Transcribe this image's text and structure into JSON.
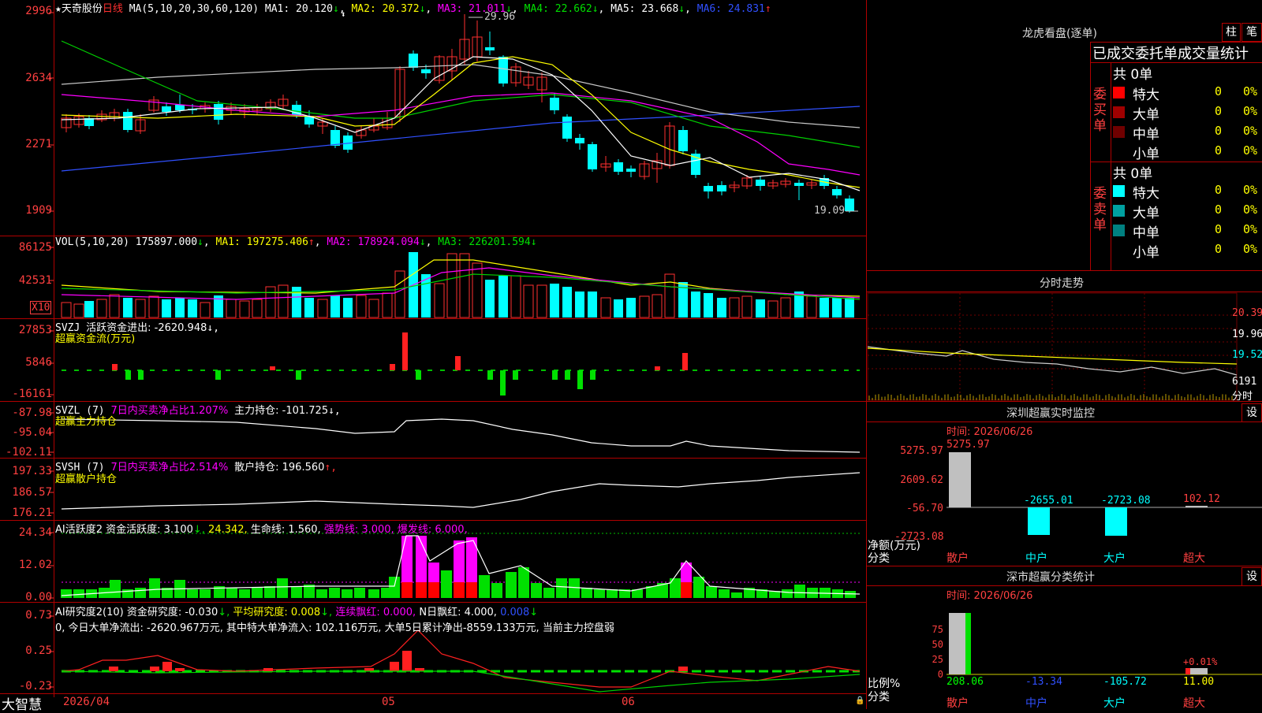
{
  "stock": {
    "star": "★",
    "name": "天奇股份",
    "period": "日线"
  },
  "price_panel": {
    "ma_params": "MA(5,10,20,30,60,120)",
    "ma1": "MA1: 20.120",
    "ma1_arrow": "↓",
    "ma2": "MA2: 20.372",
    "ma2_arrow": "↓",
    "ma3": "MA3: 21.011",
    "ma3_arrow": "↓",
    "ma4": "MA4: 22.662",
    "ma4_arrow": "↓",
    "ma5": "MA5: 23.668",
    "ma5_arrow": "↓",
    "ma6": "MA6: 24.831",
    "ma6_arrow": "↑",
    "y_labels": [
      "2996",
      "2634",
      "2271",
      "1909"
    ],
    "high_label": "29.96",
    "low_label": "19.09"
  },
  "vol_panel": {
    "title": "VOL(5,10,20)",
    "value": "175897.000",
    "arrow": "↓",
    "ma1": "MA1: 197275.406",
    "ma1_arrow": "↑",
    "ma2": "MA2: 178924.094",
    "ma2_arrow": "↓",
    "ma3": "MA3: 226201.594",
    "ma3_arrow": "↓",
    "y_labels": [
      "86125",
      "42531"
    ],
    "unit": "X10"
  },
  "svzj_panel": {
    "title": "SVZJ",
    "label": "活跃资金进出: -2620.948",
    "arrow": "↓,",
    "subtitle": "超赢资金流(万元)",
    "y_labels": [
      "27853",
      "5846",
      "-16161"
    ]
  },
  "svzl_panel": {
    "title": "SVZL (7)",
    "ratio": "7日内买卖净占比1.207%",
    "holding": "主力持仓: -101.725",
    "arrow": "↓,",
    "subtitle": "超赢主力持仓",
    "y_labels": [
      "-87.98",
      "-95.04",
      "-102.11"
    ]
  },
  "svsh_panel": {
    "title": "SVSH (7)",
    "ratio": "7日内买卖净占比2.514%",
    "holding": "散户持仓: 196.560",
    "arrow": "↑,",
    "subtitle": "超赢散户持仓",
    "y_labels": [
      "197.33",
      "186.57",
      "176.21"
    ]
  },
  "ai_active_panel": {
    "title": "AI活跃度2",
    "l1": "资金活跃度: 3.100",
    "l1a": "↓,",
    "l2": "24.342,",
    "l3": "生命线: 1.560,",
    "l4": "强势线: 3.000,",
    "l5": "爆发线: 6.000,",
    "y_labels": [
      "24.34",
      "12.02",
      "0.00"
    ]
  },
  "ai_research_panel": {
    "title": "AI研究度2(10)",
    "l1": "资金研究度: -0.030",
    "l1a": "↓,",
    "l2": "平均研究度: 0.008",
    "l2a": "↓,",
    "l3": "连续飘红: 0.000,",
    "l4": "N日飘红: 4.000,",
    "l5": "0.008",
    "l5a": "↓",
    "summary": "0, 今日大单净流出: -2620.967万元, 其中特大单净流入: 102.116万元, 大单5日累计净出-8559.133万元, 当前主力控盘弱",
    "y_labels": [
      "0.73",
      "0.25",
      "-0.23"
    ]
  },
  "bottom_axis": {
    "logo": "大智慧",
    "dates": [
      "2026/04",
      "05",
      "06"
    ]
  },
  "right": {
    "lhb_title": "龙虎看盘(逐单)",
    "btn_zhu": "柱",
    "btn_bi": "笔",
    "section_title": "已成交委托单成交量统计",
    "buy_label": "委买单",
    "sell_label": "委卖单",
    "buy_total": "共 0单",
    "sell_total": "共 0单",
    "buy_rows": [
      {
        "name": "特大",
        "count": "0",
        "pct": "0%",
        "color": "#ff0000"
      },
      {
        "name": "大单",
        "count": "0",
        "pct": "0%",
        "color": "#a00000"
      },
      {
        "name": "中单",
        "count": "0",
        "pct": "0%",
        "color": "#700000"
      },
      {
        "name": "小单",
        "count": "0",
        "pct": "0%",
        "color": "#000000"
      }
    ],
    "sell_rows": [
      {
        "name": "特大",
        "count": "0",
        "pct": "0%",
        "color": "#00ffff"
      },
      {
        "name": "大单",
        "count": "0",
        "pct": "0%",
        "color": "#00a0a0"
      },
      {
        "name": "中单",
        "count": "0",
        "pct": "0%",
        "color": "#008080"
      },
      {
        "name": "小单",
        "count": "0",
        "pct": "0%",
        "color": "#000000"
      }
    ],
    "fenshi_title": "分时走势",
    "fenshi_labels": [
      "20.39",
      "19.96",
      "19.52",
      "6191",
      "分时"
    ],
    "monitor_title": "深圳超赢实时监控",
    "monitor_btn": "设",
    "monitor_time": "时间: 2026/06/26",
    "monitor_y": [
      "5275.97",
      "2609.62",
      "-56.70",
      "-2723.08"
    ],
    "monitor_values": [
      "5275.97",
      "-2655.01",
      "-2723.08",
      "102.12"
    ],
    "monitor_ylabel": "净额(万元)",
    "monitor_xlabel": "分类",
    "categories": [
      "散户",
      "中户",
      "大户",
      "超大"
    ],
    "stats_title": "深市超赢分类统计",
    "stats_btn": "设",
    "stats_time": "时间: 2026/06/26",
    "stats_y": [
      "75",
      "50",
      "25",
      "0"
    ],
    "stats_values": [
      "208.06",
      "-13.34",
      "-105.72",
      "11.00"
    ],
    "stats_small": "+0.01%",
    "stats_ylabel": "比例%",
    "stats_xlabel": "分类"
  }
}
